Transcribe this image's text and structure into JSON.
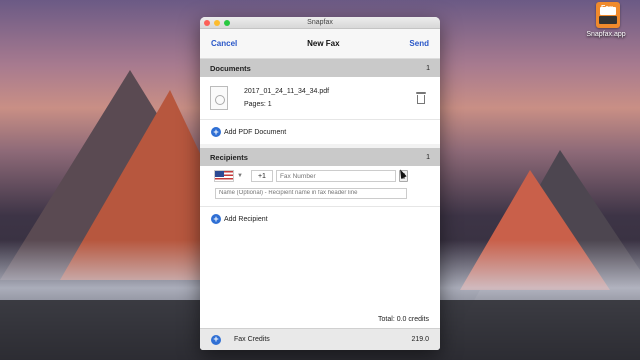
{
  "desktop": {
    "icon_caption": "Fax",
    "icon_label": "Snapfax.app"
  },
  "window": {
    "title": "Snapfax"
  },
  "navbar": {
    "cancel_label": "Cancel",
    "title": "New Fax",
    "send_label": "Send"
  },
  "documents": {
    "header": "Documents",
    "count": "1",
    "file_name": "2017_01_24_11_34_34.pdf",
    "pages": "Pages: 1",
    "add_label": "Add PDF Document"
  },
  "recipients": {
    "header": "Recipients",
    "count": "1",
    "country_code": "+1",
    "fax_placeholder": "Fax Number",
    "name_placeholder": "Name (Optional) - Recipient name in fax header line",
    "add_label": "Add Recipient"
  },
  "summary": {
    "total": "Total: 0.0 credits"
  },
  "footer": {
    "label": "Fax Credits",
    "amount": "219.0"
  }
}
